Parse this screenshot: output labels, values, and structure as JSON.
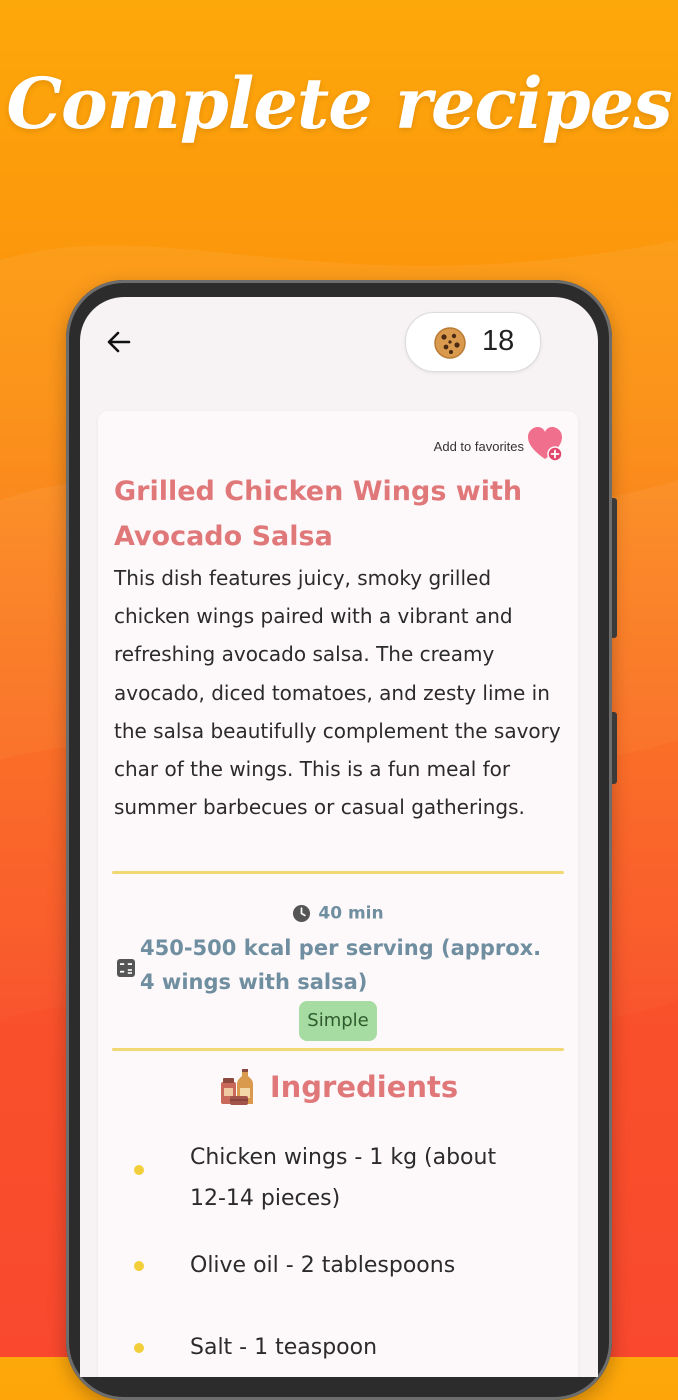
{
  "banner": {
    "headline": "Complete recipes"
  },
  "topbar": {
    "coin_count": "18"
  },
  "recipe": {
    "favorite_label": "Add to favorites",
    "title": "Grilled Chicken Wings with Avocado Salsa",
    "description": "This dish features juicy, smoky grilled chicken wings paired with a vibrant and refreshing avocado salsa. The creamy avocado, diced tomatoes, and zesty lime in the salsa beautifully complement the savory char of the wings. This is a fun meal for summer barbecues or casual gatherings.",
    "time": "40 min",
    "calories": "450-500 kcal per serving (approx. 4 wings with salsa)",
    "difficulty": "Simple"
  },
  "ingredients": {
    "heading": "Ingredients",
    "items": [
      "Chicken wings - 1 kg (about 12-14 pieces)",
      "Olive oil - 2 tablespoons",
      "Salt - 1 teaspoon"
    ]
  },
  "colors": {
    "background_top": "#fda80a",
    "background_bottom": "#f93a1e",
    "title_accent": "#e0787a",
    "meta_text": "#6f8ea0",
    "divider": "#f2d873",
    "badge_bg": "#a6dba1",
    "bullet": "#f2cf3a"
  },
  "icons": {
    "back": "arrow-left-icon",
    "coins": "cookie-icon",
    "favorite": "heart-plus-icon",
    "time": "clock-icon",
    "calories": "calculator-icon",
    "ingredients": "pantry-jars-icon"
  }
}
